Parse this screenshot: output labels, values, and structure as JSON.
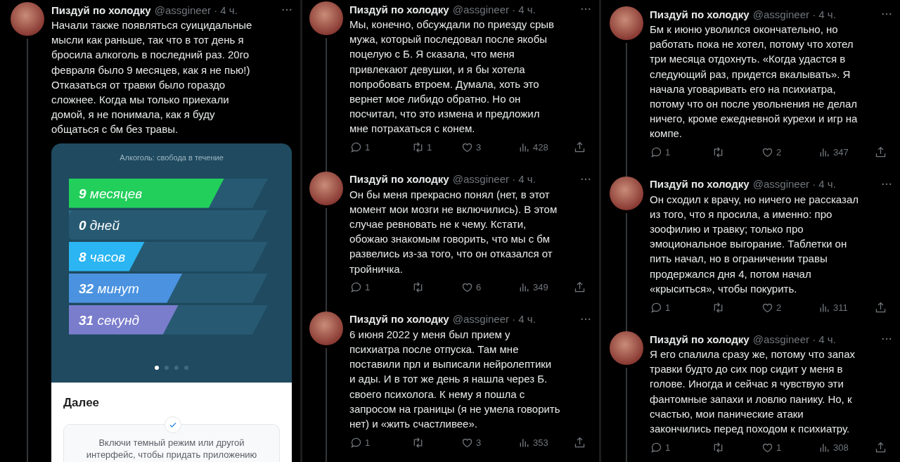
{
  "columns": [
    {
      "tweets": [
        {
          "author": "Пиздуй по холодку",
          "meta": "@assgineer · 4 ч.",
          "text": "Начали также появляться суицидальные\nмысли как раньше, так что в тот день я\nбросила алкоголь в последний раз. 20го\nфевраля было 9 месяцев, как я не пью!)\nОтказаться от травки было гораздо\nсложнее. Когда мы только приехали\nдомой, я не понимала, как я буду\nобщаться с бм без травы.",
          "media": {
            "title": "Алкоголь: свобода в течение",
            "bars": [
              {
                "label": "**9** месяцев",
                "level": 0.78,
                "color": "#22cf5b"
              },
              {
                "label": "**0** дней",
                "level": 0
              },
              {
                "label": "**8** часов",
                "level": 0.38,
                "color": "#2bb5f2"
              },
              {
                "label": "**32** минут",
                "level": 0.57,
                "color": "#4b93e0"
              },
              {
                "label": "**31** секунд",
                "level": 0.55,
                "color": "#7a7ccc"
              }
            ],
            "pages": [
              {
                "selected": true
              },
              {
                "selected": false
              },
              {
                "selected": false
              },
              {
                "selected": false
              }
            ],
            "heading": "Далее",
            "tip": "Включи темный режим или другой\nинтерфейс, чтобы придать приложению"
          }
        }
      ]
    },
    {
      "tweets": [
        {
          "author": "Пиздуй по холодку",
          "meta": "@assgineer · 4 ч.",
          "text": "Мы, конечно, обсуждали по приезду срыв\nмужа, который последовал после якобы\nпоцелую с Б. Я сказала, что меня\nпривлекают девушки, и я бы хотела\nпопробовать втроем. Думала, хоть это\nвернет мое либидо обратно. Но он\nпосчитал, что это измена и предложил\nмне потрахаться с конем.",
          "stats": {
            "replies": "1",
            "reposts": "1",
            "likes": "3",
            "views": "428"
          }
        },
        {
          "author": "Пиздуй по холодку",
          "meta": "@assgineer · 4 ч.",
          "text": "Он бы меня прекрасно понял (нет, в этот\nмомент мои мозги не включились). В этом\nслучае ревновать не к чему. Кстати,\nобожаю знакомым говорить, что мы с бм\nразвелись из-за того, что он отказался от\nтройничка.",
          "stats": {
            "replies": "1",
            "likes": "6",
            "views": "349"
          }
        },
        {
          "author": "Пиздуй по холодку",
          "meta": "@assgineer · 4 ч.",
          "text": "6 июня 2022 у меня был прием у\nпсихиатра после отпуска. Там мне\nпоставили прл и выписали нейролептики\nи ады. И в тот же день я нашла через Б.\nсвоего психолога. К нему я пошла с\nзапросом на границы (я не умела говорить\nнет) и «жить счастливее».",
          "stats": {
            "replies": "1",
            "likes": "3",
            "views": "353"
          }
        }
      ]
    },
    {
      "tweets": [
        {
          "author": "Пиздуй по холодку",
          "meta": "@assgineer · 4 ч.",
          "text": "Бм к июню уволился окончательно, но\nработать пока не хотел, потому что хотел\nтри месяца отдохнуть. «Когда удастся в\nследующий раз, придется вкалывать». Я\nначала уговаривать его на психиатра,\nпотому что он после увольнения не делал\nничего, кроме ежедневной курехи и игр на\nкомпе.",
          "stats": {
            "replies": "1",
            "likes": "2",
            "views": "347"
          }
        },
        {
          "author": "Пиздуй по холодку",
          "meta": "@assgineer · 4 ч.",
          "text": "Он сходил к врачу, но ничего не рассказал\nиз того, что я просила, а именно: про\nзоофилию и травку; только про\nэмоциональное выгорание. Таблетки он\nпить начал, но в ограничении травы\nпродержался дня 4, потом начал\n«крыситься», чтобы покурить.",
          "stats": {
            "replies": "1",
            "likes": "2",
            "views": "311"
          }
        },
        {
          "author": "Пиздуй по холодку",
          "meta": "@assgineer · 4 ч.",
          "text": "Я его спалила сразу же, потому что запах\nтравки будто до сих пор сидит у меня в\nголове. Иногда и сейчас я чувствую эти\nфантомные запахи и ловлю панику. Но, к\nсчастью, мои панические атаки\nзакончились перед походом к психиатру.",
          "stats": {
            "replies": "1",
            "likes": "1",
            "views": "308"
          }
        }
      ]
    }
  ]
}
